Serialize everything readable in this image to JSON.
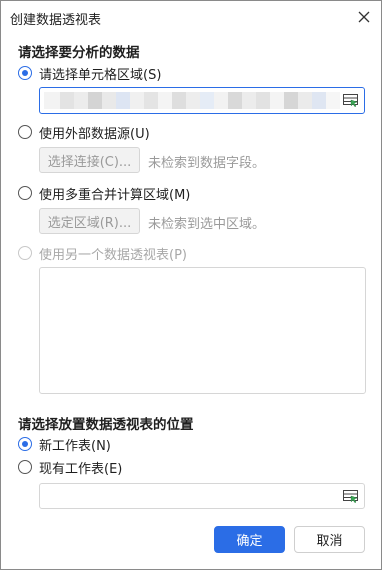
{
  "dialog": {
    "title": "创建数据透视表",
    "close_icon": "close-icon"
  },
  "source_section": {
    "header": "请选择要分析的数据",
    "options": [
      {
        "label": "请选择单元格区域(S)",
        "checked": true,
        "disabled": false
      },
      {
        "label": "使用外部数据源(U)",
        "checked": false,
        "disabled": false
      },
      {
        "label": "使用多重合并计算区域(M)",
        "checked": false,
        "disabled": false
      },
      {
        "label": "使用另一个数据透视表(P)",
        "checked": false,
        "disabled": true
      }
    ],
    "range_input": {
      "value": "",
      "picker_icon": "range-picker-icon"
    },
    "external": {
      "button_label": "选择连接(C)...",
      "hint": "未检索到数据字段。"
    },
    "consolidate": {
      "button_label": "选定区域(R)...",
      "hint": "未检索到选中区域。"
    }
  },
  "dest_section": {
    "header": "请选择放置数据透视表的位置",
    "options": [
      {
        "label": "新工作表(N)",
        "checked": true
      },
      {
        "label": "现有工作表(E)",
        "checked": false
      }
    ],
    "dest_input": {
      "value": "",
      "picker_icon": "range-picker-icon"
    }
  },
  "footer": {
    "ok_label": "确定",
    "cancel_label": "取消"
  },
  "colors": {
    "accent": "#2b6de6",
    "disabled_text": "#a8a8a8",
    "border": "#d6d6d6"
  }
}
